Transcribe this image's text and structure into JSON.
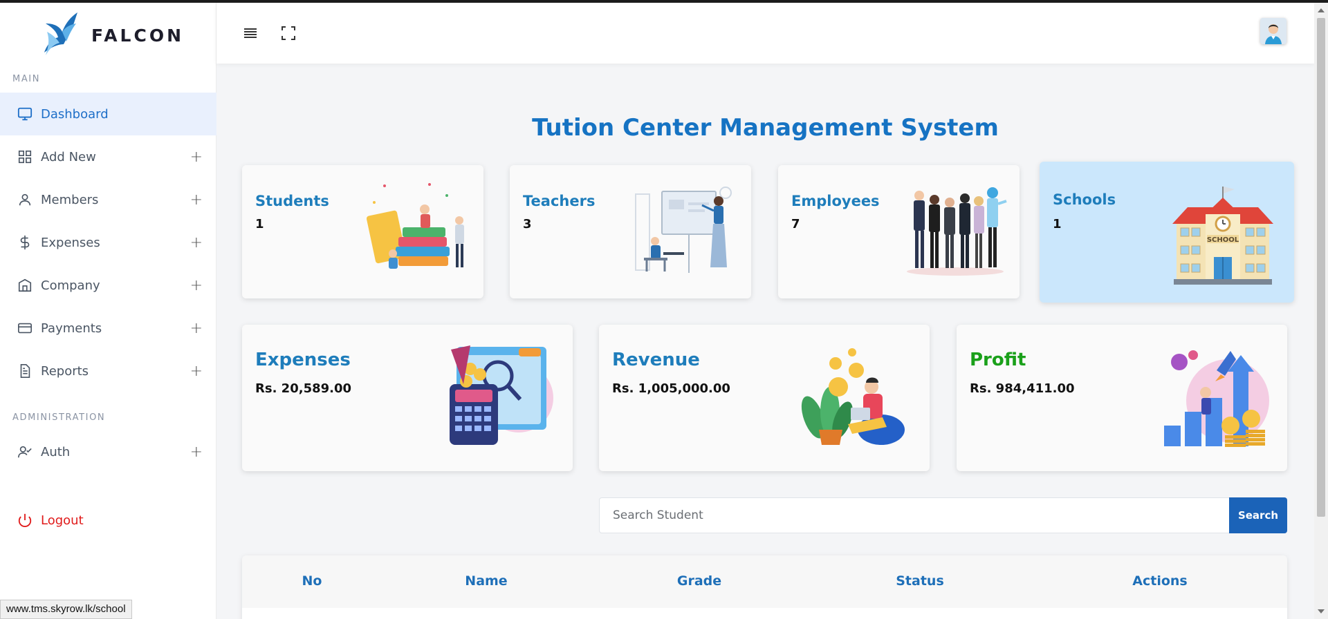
{
  "brand": {
    "name": "FALCON"
  },
  "sidebar": {
    "main_label": "MAIN",
    "admin_label": "ADMINISTRATION",
    "items": [
      {
        "label": "Dashboard",
        "icon": "monitor-icon",
        "expandable": false,
        "active": true
      },
      {
        "label": "Add New",
        "icon": "grid-icon",
        "expandable": true
      },
      {
        "label": "Members",
        "icon": "user-icon",
        "expandable": true
      },
      {
        "label": "Expenses",
        "icon": "dollar-icon",
        "expandable": true
      },
      {
        "label": "Company",
        "icon": "building-icon",
        "expandable": true
      },
      {
        "label": "Payments",
        "icon": "credit-card-icon",
        "expandable": true
      },
      {
        "label": "Reports",
        "icon": "document-icon",
        "expandable": true
      }
    ],
    "admin_items": [
      {
        "label": "Auth",
        "icon": "user-check-icon",
        "expandable": true
      }
    ],
    "plus": "+",
    "logout": {
      "label": "Logout",
      "icon": "power-icon",
      "color": "#e01a1a"
    }
  },
  "header": {
    "menu_icon": "hamburger-icon",
    "fullscreen_icon": "fullscreen-icon",
    "avatar_icon": "user-avatar-icon"
  },
  "main": {
    "title": "Tution Center Management System",
    "stat_cards": [
      {
        "title": "Students",
        "value": "1"
      },
      {
        "title": "Teachers",
        "value": "3"
      },
      {
        "title": "Employees",
        "value": "7"
      },
      {
        "title": "Schools",
        "value": "1",
        "highlighted": true
      }
    ],
    "finance_cards": [
      {
        "title": "Expenses",
        "value": "Rs. 20,589.00",
        "color": "#1e7dbb"
      },
      {
        "title": "Revenue",
        "value": "Rs. 1,005,000.00",
        "color": "#1e7dbb"
      },
      {
        "title": "Profit",
        "value": "Rs. 984,411.00",
        "color": "#1aa01a"
      }
    ],
    "search": {
      "placeholder": "Search Student",
      "button": "Search"
    },
    "table": {
      "headers": [
        "No",
        "Name",
        "Grade",
        "Status",
        "Actions"
      ]
    }
  },
  "school_sign": "SCHOOL",
  "statusbar": {
    "url": "www.tms.skyrow.lk/school"
  },
  "colors": {
    "accent": "#1673c3",
    "active_bg": "#e9f0fd",
    "button": "#1b63b8"
  }
}
